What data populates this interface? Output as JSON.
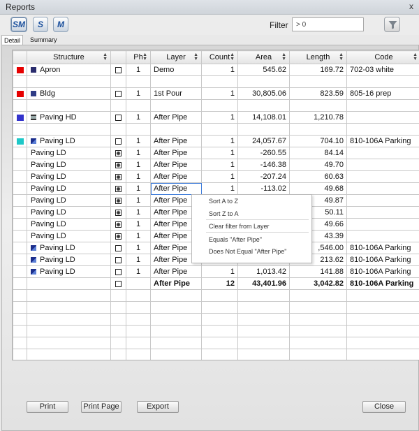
{
  "window": {
    "title": "Reports",
    "close_glyph": "x"
  },
  "toolbar": {
    "buttons": [
      {
        "label": "SM",
        "icon": "style-manager-icon"
      },
      {
        "label": "S",
        "icon": "style-icon"
      },
      {
        "label": "M",
        "icon": "model-icon"
      }
    ],
    "filter_label": "Filter",
    "filter_value": "> 0",
    "filter_button_icon": "funnel-icon"
  },
  "tabs": [
    {
      "label": "Detail",
      "active": true
    },
    {
      "label": "Summary",
      "active": false
    }
  ],
  "table": {
    "columns": [
      "",
      "Structure",
      "",
      "Ph",
      "Layer",
      "Count",
      "Area",
      "Length",
      "Code"
    ],
    "rows": [
      {
        "swatch": "#e60000",
        "icon": "apron-icon",
        "structure": "Apron",
        "check": false,
        "ph": "1",
        "layer": "Demo",
        "count": "1",
        "area": "545.62",
        "length": "169.72",
        "code": "702-03 white"
      },
      {
        "blank": true
      },
      {
        "swatch": "#e60000",
        "icon": "bldg-icon",
        "structure": "Bldg",
        "check": false,
        "ph": "1",
        "layer": "1st Pour",
        "count": "1",
        "area": "30,805.06",
        "length": "823.59",
        "code": "805-16 prep"
      },
      {
        "blank": true
      },
      {
        "swatch": "#3333cc",
        "icon": "paving-hd-icon",
        "structure": "Paving HD",
        "check": false,
        "ph": "1",
        "layer": "After Pipe",
        "count": "1",
        "area": "14,108.01",
        "length": "1,210.78",
        "code": ""
      },
      {
        "blank": true
      },
      {
        "swatch": "#1ec8c8",
        "icon": "paving-ld-icon",
        "structure": "Paving LD",
        "check": false,
        "ph": "1",
        "layer": "After Pipe",
        "count": "1",
        "area": "24,057.67",
        "length": "704.10",
        "code": "810-106A Parking"
      },
      {
        "structure": "Paving LD",
        "check": true,
        "ph": "1",
        "layer": "After Pipe",
        "count": "1",
        "area": "-260.55",
        "length": "84.14",
        "code": ""
      },
      {
        "structure": "Paving LD",
        "check": true,
        "ph": "1",
        "layer": "After Pipe",
        "count": "1",
        "area": "-146.38",
        "length": "49.70",
        "code": ""
      },
      {
        "structure": "Paving LD",
        "check": true,
        "ph": "1",
        "layer": "After Pipe",
        "count": "1",
        "area": "-207.24",
        "length": "60.63",
        "code": ""
      },
      {
        "structure": "Paving LD",
        "check": true,
        "ph": "1",
        "layer": "After Pipe",
        "count": "1",
        "area": "-113.02",
        "length": "49.68",
        "code": "",
        "selected": true
      },
      {
        "structure": "Paving LD",
        "check": true,
        "ph": "1",
        "layer": "After Pipe",
        "count": "",
        "area": "",
        "length": "49.87",
        "code": ""
      },
      {
        "structure": "Paving LD",
        "check": true,
        "ph": "1",
        "layer": "After Pipe",
        "count": "",
        "area": "",
        "length": "50.11",
        "code": ""
      },
      {
        "structure": "Paving LD",
        "check": true,
        "ph": "1",
        "layer": "After Pipe",
        "count": "",
        "area": "",
        "length": "49.66",
        "code": ""
      },
      {
        "structure": "Paving LD",
        "check": true,
        "ph": "1",
        "layer": "After Pipe",
        "count": "",
        "area": "",
        "length": "43.39",
        "code": ""
      },
      {
        "icon": "paving-ld-icon",
        "structure": "Paving LD",
        "check": false,
        "ph": "1",
        "layer": "After Pipe",
        "count": "",
        "area": "",
        "length": ",546.00",
        "code": "810-106A Parking"
      },
      {
        "icon": "paving-ld-icon",
        "structure": "Paving LD",
        "check": false,
        "ph": "1",
        "layer": "After Pipe",
        "count": "",
        "area": "",
        "length": "213.62",
        "code": "810-106A Parking"
      },
      {
        "icon": "paving-ld-icon",
        "structure": "Paving LD",
        "check": false,
        "ph": "1",
        "layer": "After Pipe",
        "count": "1",
        "area": "1,013.42",
        "length": "141.88",
        "code": "810-106A Parking"
      },
      {
        "total": true,
        "structure": "",
        "check": false,
        "ph": "",
        "layer": "After Pipe",
        "count": "12",
        "area": "43,401.96",
        "length": "3,042.82",
        "code": "810-106A Parking"
      }
    ],
    "empty_rows": 6
  },
  "context_menu": {
    "items": [
      "Sort A to Z",
      "Sort Z to A",
      "Clear filter from Layer",
      "Equals \"After Pipe\"",
      "Does Not Equal \"After Pipe\""
    ]
  },
  "footer": {
    "print": "Print",
    "print_page": "Print Page",
    "export": "Export",
    "close": "Close"
  }
}
